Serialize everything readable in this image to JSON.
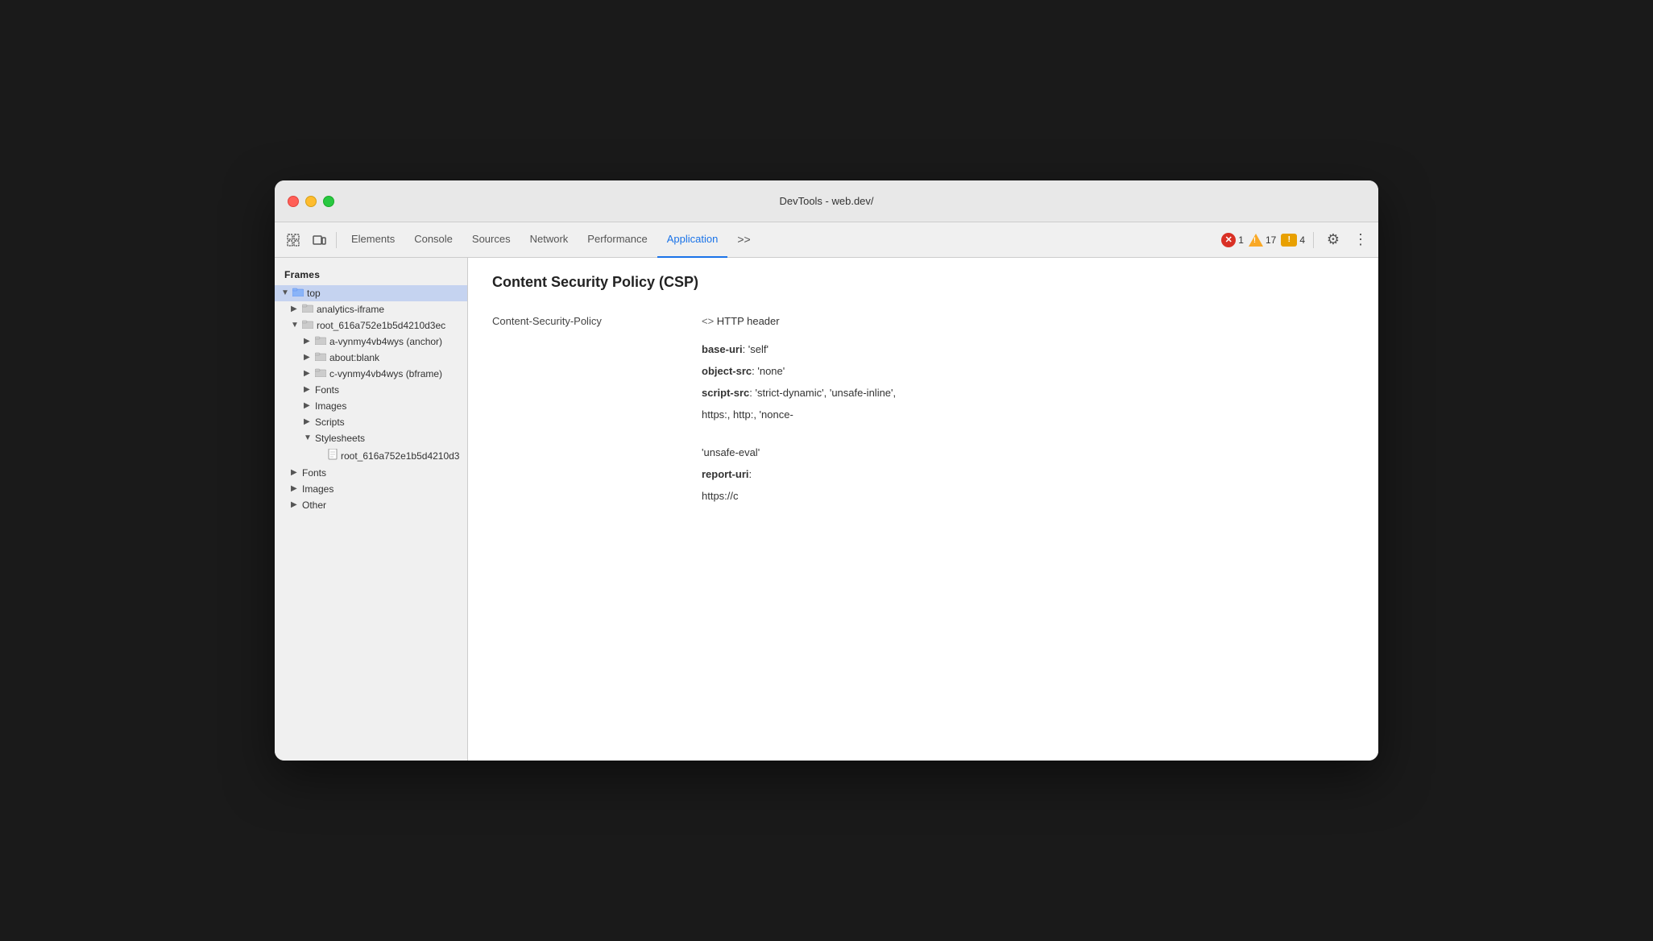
{
  "window": {
    "title": "DevTools - web.dev/"
  },
  "toolbar": {
    "icons": [
      "select-icon",
      "device-icon"
    ],
    "tabs": [
      {
        "id": "elements",
        "label": "Elements",
        "active": false
      },
      {
        "id": "console",
        "label": "Console",
        "active": false
      },
      {
        "id": "sources",
        "label": "Sources",
        "active": false
      },
      {
        "id": "network",
        "label": "Network",
        "active": false
      },
      {
        "id": "performance",
        "label": "Performance",
        "active": false
      },
      {
        "id": "application",
        "label": "Application",
        "active": true
      }
    ],
    "more_tabs_label": ">>",
    "badges": {
      "errors": {
        "count": "1",
        "color": "#d93025"
      },
      "warnings": {
        "count": "17",
        "color": "#f9a825"
      },
      "info": {
        "count": "4",
        "color": "#e8a000"
      }
    }
  },
  "sidebar": {
    "section_title": "Frames",
    "tree": [
      {
        "id": "top",
        "label": "top",
        "indent": 0,
        "arrow": "open",
        "type": "folder",
        "selected": true
      },
      {
        "id": "analytics-iframe",
        "label": "analytics-iframe",
        "indent": 1,
        "arrow": "closed",
        "type": "folder",
        "selected": false
      },
      {
        "id": "root_616a752e1b5d4210d3ec",
        "label": "root_616a752e1b5d4210d3ec",
        "indent": 1,
        "arrow": "open",
        "type": "folder",
        "selected": false
      },
      {
        "id": "a-vynmy4vb4wys",
        "label": "a-vynmy4vb4wys (anchor)",
        "indent": 2,
        "arrow": "closed",
        "type": "folder",
        "selected": false
      },
      {
        "id": "about-blank",
        "label": "about:blank",
        "indent": 2,
        "arrow": "closed",
        "type": "folder",
        "selected": false
      },
      {
        "id": "c-vynmy4vb4wys",
        "label": "c-vynmy4vb4wys (bframe)",
        "indent": 2,
        "arrow": "closed",
        "type": "folder",
        "selected": false
      },
      {
        "id": "fonts-sub",
        "label": "Fonts",
        "indent": 2,
        "arrow": "closed",
        "type": "group",
        "selected": false
      },
      {
        "id": "images-sub",
        "label": "Images",
        "indent": 2,
        "arrow": "closed",
        "type": "group",
        "selected": false
      },
      {
        "id": "scripts-sub",
        "label": "Scripts",
        "indent": 2,
        "arrow": "closed",
        "type": "group",
        "selected": false
      },
      {
        "id": "stylesheets-sub",
        "label": "Stylesheets",
        "indent": 2,
        "arrow": "open",
        "type": "group",
        "selected": false
      },
      {
        "id": "stylesheet-file",
        "label": "root_616a752e1b5d4210d3",
        "indent": 3,
        "arrow": "none",
        "type": "file",
        "selected": false
      },
      {
        "id": "fonts-top",
        "label": "Fonts",
        "indent": 1,
        "arrow": "closed",
        "type": "group",
        "selected": false
      },
      {
        "id": "images-top",
        "label": "Images",
        "indent": 1,
        "arrow": "closed",
        "type": "group",
        "selected": false
      },
      {
        "id": "other-top",
        "label": "Other",
        "indent": 1,
        "arrow": "closed",
        "type": "group",
        "selected": false
      }
    ]
  },
  "detail": {
    "title": "Content Security Policy (CSP)",
    "rows": [
      {
        "key": "Content-Security-Policy",
        "value_type": "http_header",
        "value": "HTTP header"
      },
      {
        "key": "",
        "value_type": "property",
        "prop_name": "base-uri",
        "prop_value": ": 'self'"
      },
      {
        "key": "",
        "value_type": "property",
        "prop_name": "object-src",
        "prop_value": ": 'none'"
      },
      {
        "key": "",
        "value_type": "property",
        "prop_name": "script-src",
        "prop_value": ": 'strict-dynamic', 'unsafe-inline',"
      },
      {
        "key": "",
        "value_type": "text",
        "text": "https:, http:, 'nonce-"
      },
      {
        "key": "",
        "value_type": "text",
        "text": ""
      },
      {
        "key": "",
        "value_type": "text",
        "text": "'unsafe-eval'"
      },
      {
        "key": "",
        "value_type": "property",
        "prop_name": "report-uri",
        "prop_value": ":"
      },
      {
        "key": "",
        "value_type": "text",
        "text": "https://c"
      }
    ]
  }
}
